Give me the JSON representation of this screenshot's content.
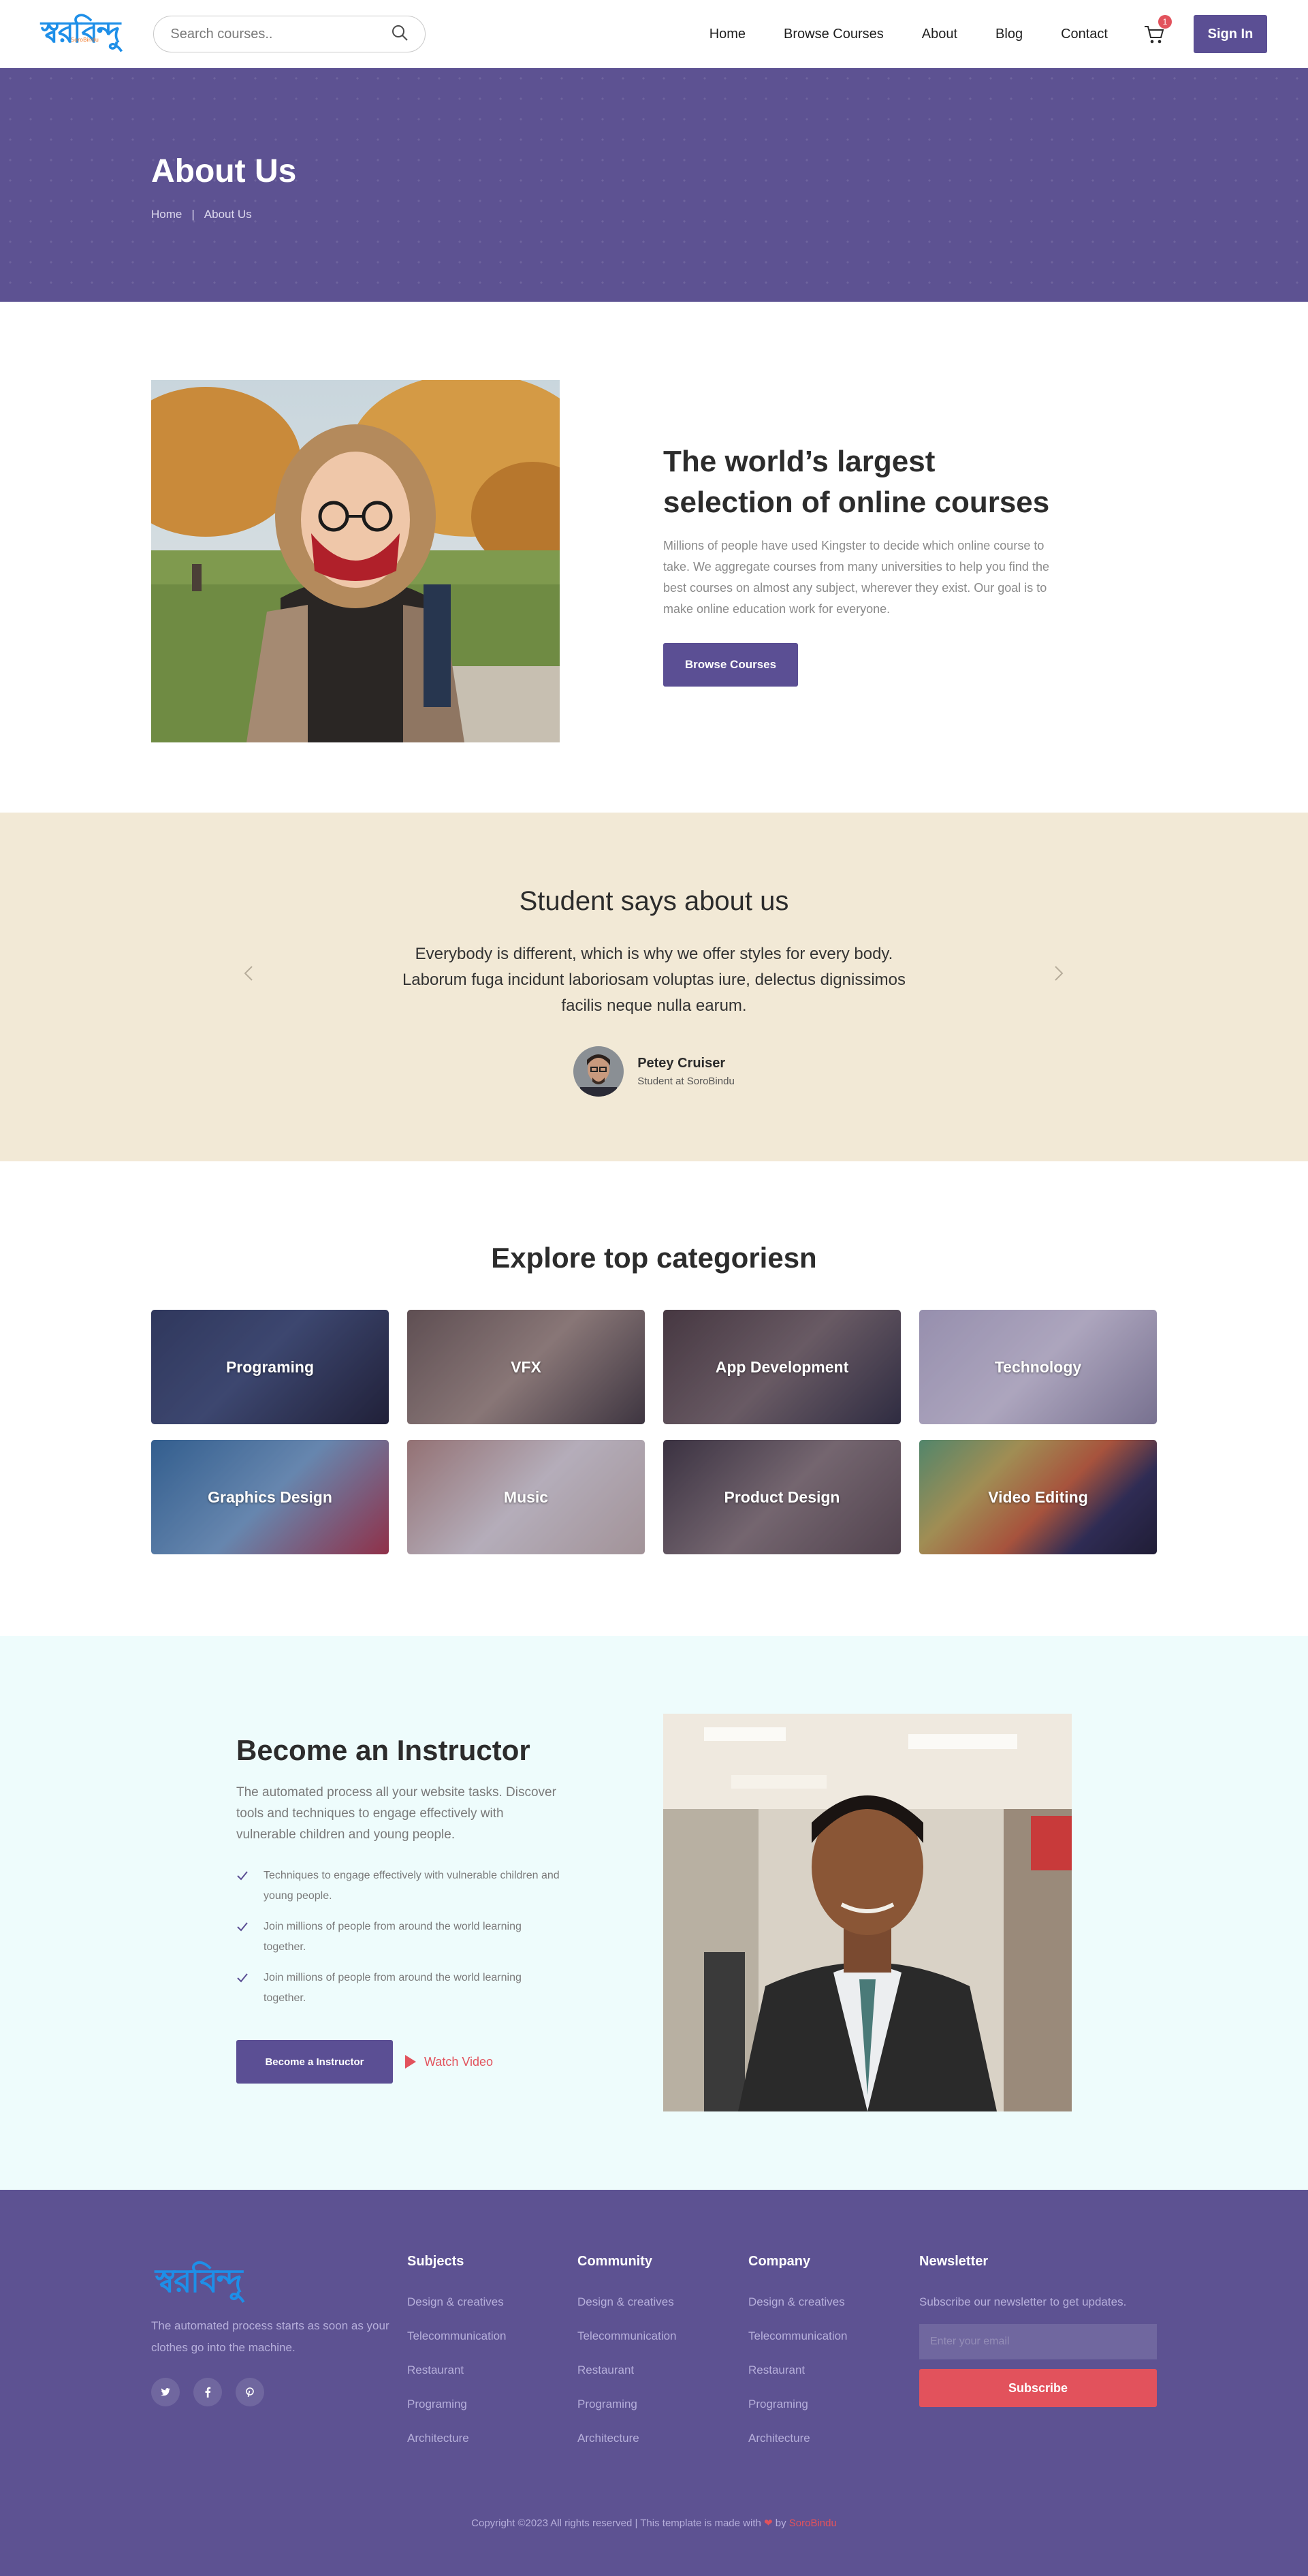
{
  "header": {
    "logo_text": "স্বরবিন্দু",
    "logo_sub": "SoroBindu",
    "search_placeholder": "Search courses..",
    "nav": [
      "Home",
      "Browse Courses",
      "About",
      "Blog",
      "Contact"
    ],
    "cart_count": "1",
    "signin_label": "Sign In"
  },
  "banner": {
    "title": "About Us",
    "crumb_home": "Home",
    "crumb_sep": "|",
    "crumb_current": "About Us"
  },
  "about": {
    "title": "The world’s largest selection of online courses",
    "body": "Millions of people have used Kingster to decide which online course to take. We aggregate courses from many universities to help you find the best courses on almost any subject, wherever they exist. Our goal is to make online education work for everyone.",
    "button_label": "Browse Courses"
  },
  "testimonial": {
    "title": "Student says about us",
    "quote": "Everybody is different, which is why we offer styles for every body. Laborum fuga incidunt laboriosam voluptas iure, delectus dignissimos facilis neque nulla earum.",
    "name": "Petey Cruiser",
    "role": "Student at SoroBindu"
  },
  "categories": {
    "title": "Explore top categoriesn",
    "items": [
      "Programing",
      "VFX",
      "App Development",
      "Technology",
      "Graphics Design",
      "Music",
      "Product Design",
      "Video Editing"
    ]
  },
  "instructor": {
    "title": "Become an Instructor",
    "lead": "The automated process all your website tasks. Discover tools and techniques to engage effectively with vulnerable children and young people.",
    "points": [
      "Techniques to engage effectively with vulnerable children and young people.",
      "Join millions of people from around the world learning together.",
      "Join millions of people from around the world learning together."
    ],
    "button_label": "Become a Instructor",
    "watch_label": "Watch Video"
  },
  "footer": {
    "logo_text": "স্বরবিন্দু",
    "about": "The automated process starts as soon as your clothes go into the machine.",
    "columns": [
      {
        "title": "Subjects",
        "links": [
          "Design & creatives",
          "Telecommunication",
          "Restaurant",
          "Programing",
          "Architecture"
        ]
      },
      {
        "title": "Community",
        "links": [
          "Design & creatives",
          "Telecommunication",
          "Restaurant",
          "Programing",
          "Architecture"
        ]
      },
      {
        "title": "Company",
        "links": [
          "Design & creatives",
          "Telecommunication",
          "Restaurant",
          "Programing",
          "Architecture"
        ]
      }
    ],
    "newsletter": {
      "title": "Newsletter",
      "text": "Subscribe our newsletter to get updates.",
      "placeholder": "Enter your email",
      "button_label": "Subscribe"
    },
    "copyright_prefix": "Copyright ©2023 All rights reserved | This template is made with",
    "copyright_by": "by",
    "copyright_brand": "SoroBindu"
  },
  "colors": {
    "primary": "#5b4f94",
    "banner": "#5d5292",
    "accent_red": "#e2525c",
    "testimonial_bg": "#f2e9d6",
    "instructor_bg": "#eefcfc",
    "logo_blue": "#1e8fe8"
  },
  "icons": {
    "search": "search-icon",
    "cart": "cart-icon",
    "prev": "chevron-left-icon",
    "next": "chevron-right-icon",
    "check": "check-icon",
    "play": "play-icon",
    "socials": [
      "twitter-icon",
      "facebook-icon",
      "pinterest-icon"
    ]
  }
}
